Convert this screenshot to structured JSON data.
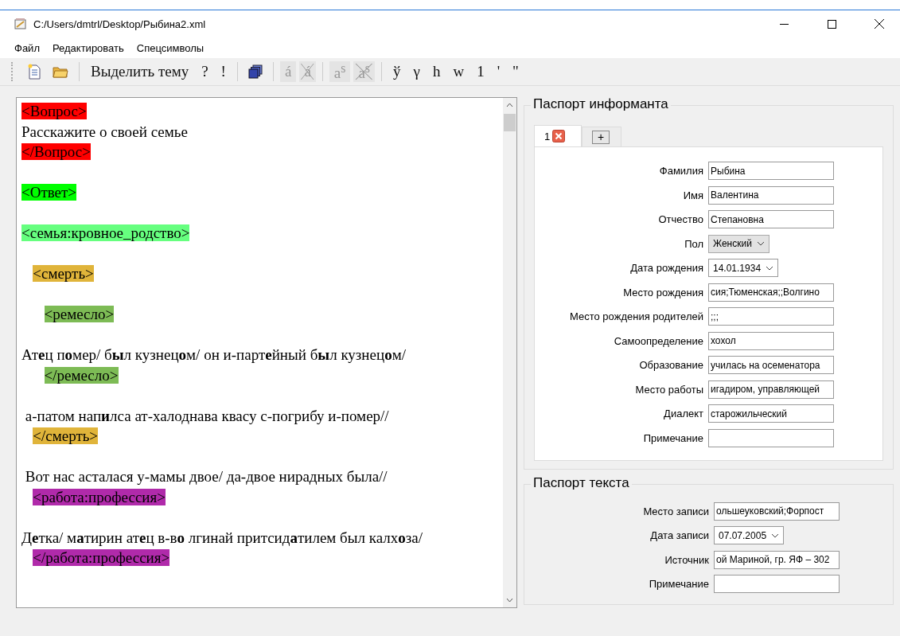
{
  "window": {
    "title": "C:/Users/dmtrl/Desktop/Рыбина2.xml"
  },
  "menu": [
    "Файл",
    "Редактировать",
    "Спецсимволы"
  ],
  "toolbar": [
    {
      "kind": "new-icon"
    },
    {
      "kind": "open-icon"
    },
    {
      "kind": "sep"
    },
    {
      "kind": "text",
      "label": "Выделить тему",
      "disabled": false
    },
    {
      "kind": "text",
      "label": "?",
      "disabled": false
    },
    {
      "kind": "text",
      "label": "!",
      "disabled": false
    },
    {
      "kind": "sep"
    },
    {
      "kind": "stack-icon"
    },
    {
      "kind": "sep"
    },
    {
      "kind": "text",
      "label": "á",
      "disabled": true
    },
    {
      "kind": "struck",
      "label": "á",
      "disabled": true
    },
    {
      "kind": "sep"
    },
    {
      "kind": "text",
      "label": "a$^{s}$",
      "disabled": true
    },
    {
      "kind": "struck",
      "label": "a$^{s}$",
      "disabled": true
    },
    {
      "kind": "sep"
    },
    {
      "kind": "text",
      "label": "ў",
      "disabled": false
    },
    {
      "kind": "text",
      "label": "γ",
      "disabled": false
    },
    {
      "kind": "text",
      "label": "h",
      "disabled": false
    },
    {
      "kind": "text",
      "label": "w",
      "disabled": false
    },
    {
      "kind": "text",
      "label": "1",
      "disabled": false
    },
    {
      "kind": "text",
      "label": "'",
      "disabled": false
    },
    {
      "kind": "text",
      "label": "\"",
      "disabled": false
    }
  ],
  "editor": {
    "lines": [
      {
        "kind": "tag",
        "text": "<Вопрос>",
        "color": "#ff0000"
      },
      {
        "kind": "text",
        "text": "Расскажите о своей семье"
      },
      {
        "kind": "tag",
        "text": "</Вопрос>",
        "color": "#ff0000"
      },
      {
        "kind": "blank"
      },
      {
        "kind": "tag",
        "text": "<Ответ>",
        "color": "#00ff00"
      },
      {
        "kind": "blank"
      },
      {
        "kind": "tag",
        "text": "<семья:кровное_родство>",
        "color": "#66ff7f"
      },
      {
        "kind": "blank"
      },
      {
        "kind": "tag",
        "text": "   <смерть>",
        "color": "#e0b43a"
      },
      {
        "kind": "blank"
      },
      {
        "kind": "tag",
        "text": "      <ремесло>",
        "color": "#7dbb55"
      },
      {
        "kind": "blank"
      },
      {
        "kind": "text",
        "text": "Ат**е**ц п**о**мер/ б**ы**л кузнец**о**м/ он и-парт**е**йный б**ы**л кузнец**о**м/"
      },
      {
        "kind": "tag",
        "text": "      </ремесло>",
        "color": "#7dbb55"
      },
      {
        "kind": "blank"
      },
      {
        "kind": "text",
        "text": " а-патом нап**и**лса ат-халоднава квасу с-погрибу и-помер//"
      },
      {
        "kind": "tag",
        "text": "   </смерть>",
        "color": "#e0b43a"
      },
      {
        "kind": "blank"
      },
      {
        "kind": "text",
        "text": " Вот нас асталася у-мамы двое/ да-двое нирадных была//"
      },
      {
        "kind": "tag",
        "text": "   <работа:профессия>",
        "color": "#b02aaa"
      },
      {
        "kind": "blank"
      },
      {
        "kind": "text",
        "text": "Д**е**тка/ м**а**тирин ат**е**ц в-в**о** лгинай притсид**а**тилем был калх**о**за/"
      },
      {
        "kind": "tag",
        "text": "   </работа:профессия>",
        "color": "#b02aaa"
      }
    ]
  },
  "informant": {
    "title": "Паспорт информанта",
    "tabs": [
      {
        "label": "1",
        "selected": true
      },
      {
        "label": "+",
        "selected": false
      }
    ],
    "fields": [
      {
        "kind": "text",
        "label": "Фамилия",
        "value": "Рыбина"
      },
      {
        "kind": "text",
        "label": "Имя",
        "value": "Валентина"
      },
      {
        "kind": "text",
        "label": "Отчество",
        "value": "Степановна"
      },
      {
        "kind": "combo",
        "label": "Пол",
        "value": "Женский"
      },
      {
        "kind": "date",
        "label": "Дата рождения",
        "value": "14.01.1934"
      },
      {
        "kind": "text",
        "label": "Место рождения",
        "value": "сия;Тюменская;;Волгино"
      },
      {
        "kind": "text",
        "label": "Место рождения родителей",
        "value": ";;;"
      },
      {
        "kind": "text",
        "label": "Самоопределение",
        "value": "хохол"
      },
      {
        "kind": "text",
        "label": "Образование",
        "value": "училась на осеменатора"
      },
      {
        "kind": "text",
        "label": "Место работы",
        "value": "игадиром, управляющей"
      },
      {
        "kind": "text",
        "label": "Диалект",
        "value": "старожильческий"
      },
      {
        "kind": "text",
        "label": "Примечание"
      }
    ]
  },
  "text_passport": {
    "title": "Паспорт текста",
    "fields": [
      {
        "kind": "text",
        "label": "Место записи",
        "value": "ольшеуковский;Форпост"
      },
      {
        "kind": "date",
        "label": "Дата записи",
        "value": "07.07.2005"
      },
      {
        "kind": "text",
        "label": "Источник",
        "value": "ой Мариной, гр. ЯФ – 302"
      },
      {
        "kind": "text",
        "label": "Примечание"
      }
    ]
  }
}
